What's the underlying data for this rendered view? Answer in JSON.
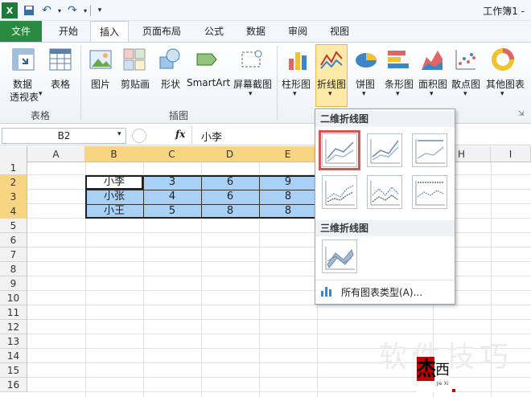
{
  "title_bar": {
    "doc_title": "工作簿1 -"
  },
  "tabs": [
    "文件",
    "开始",
    "插入",
    "页面布局",
    "公式",
    "数据",
    "审阅",
    "视图"
  ],
  "ribbon": {
    "buttons": [
      "数据\n透视表",
      "表格",
      "图片",
      "剪贴画",
      "形状",
      "SmartArt",
      "屏幕截图",
      "柱形图",
      "折线图",
      "饼图",
      "条形图",
      "面积图",
      "散点图",
      "其他图表"
    ],
    "pivot_line1": "数据",
    "pivot_line2": "透视表",
    "groups": [
      "表格",
      "插图"
    ]
  },
  "formula_bar": {
    "name_box": "B2",
    "fx": "fx",
    "value": "小李"
  },
  "sheet": {
    "columns": [
      "A",
      "B",
      "C",
      "D",
      "E",
      "H",
      "I"
    ],
    "rows": [
      "1",
      "2",
      "3",
      "4",
      "5",
      "6",
      "7",
      "8",
      "9",
      "10",
      "11",
      "12",
      "13",
      "14",
      "15",
      "16"
    ],
    "data": [
      {
        "name": "小李",
        "c": "3",
        "d": "6",
        "e": "9"
      },
      {
        "name": "小张",
        "c": "4",
        "d": "6",
        "e": "8"
      },
      {
        "name": "小王",
        "c": "5",
        "d": "8",
        "e": "8"
      }
    ]
  },
  "dropdown": {
    "section_2d": "二维折线图",
    "section_3d": "三维折线图",
    "all_types": "所有图表类型(A)..."
  },
  "watermark": {
    "text": "软件技巧",
    "logo_char1": "杰",
    "logo_char2": "西",
    "logo_sub": "Jie Xi"
  },
  "colors": {
    "file_tab": "#2a8a3f",
    "selection_fill": "#a9d0f5",
    "highlight": "#d9534f",
    "ribbon_selected": "#fde9a8"
  }
}
